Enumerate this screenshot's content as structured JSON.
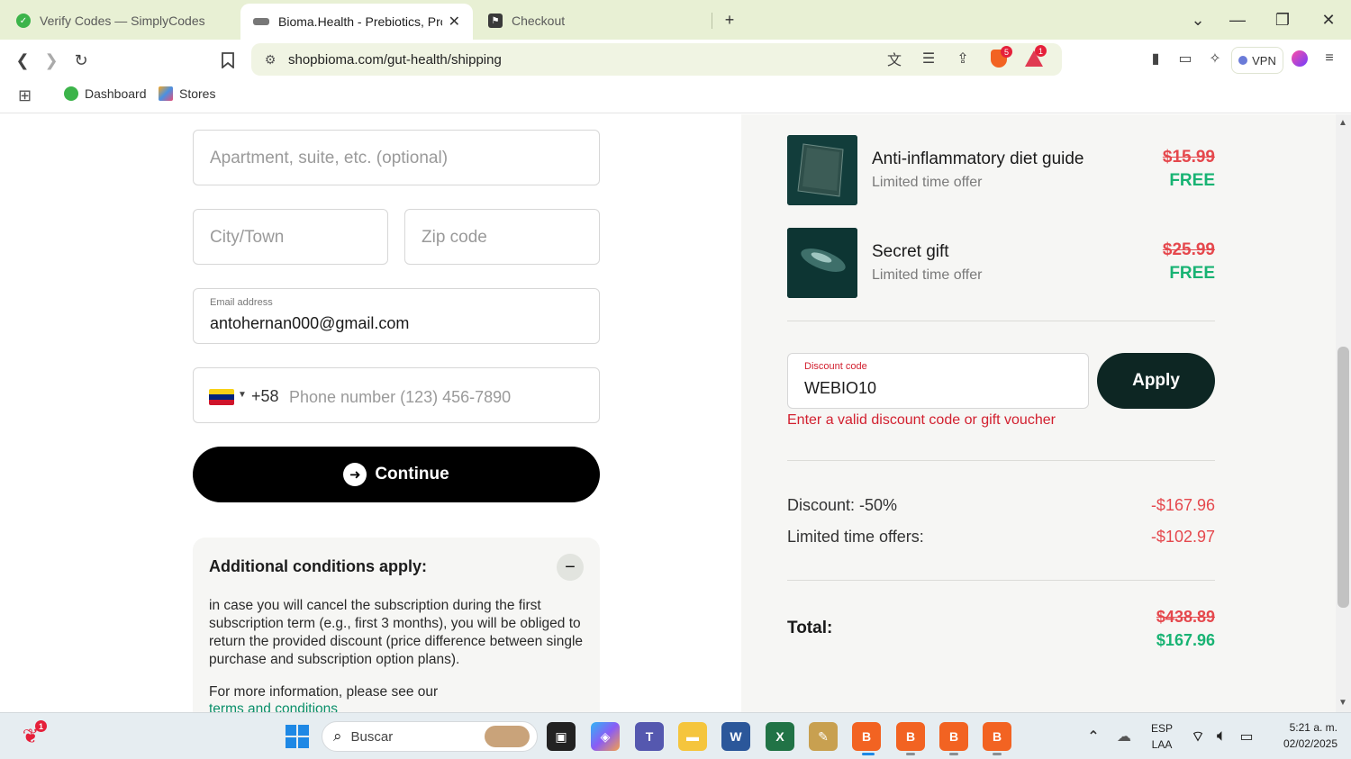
{
  "browser": {
    "tabs": [
      {
        "title": "Verify Codes — SimplyCodes",
        "active": false
      },
      {
        "title": "Bioma.Health - Prebiotics, Prob",
        "active": true
      },
      {
        "title": "Checkout",
        "active": false
      }
    ],
    "new_tab_symbol": "+",
    "url": "shopbioma.com/gut-health/shipping",
    "shield_badge": "5",
    "rewards_badge": "1",
    "vpn_label": "VPN",
    "bookmarks": [
      "Dashboard",
      "Stores"
    ]
  },
  "form": {
    "apartment_placeholder": "Apartment, suite, etc. (optional)",
    "city_placeholder": "City/Town",
    "zip_placeholder": "Zip code",
    "email_label": "Email address",
    "email_value": "antohernan000@gmail.com",
    "phone_prefix": "+58",
    "phone_placeholder": "Phone number (123) 456-7890",
    "continue_label": "Continue"
  },
  "conditions": {
    "title": "Additional conditions apply:",
    "body": "in case you will cancel the subscription during the first subscription term (e.g., first 3 months), you will be obliged to return the provided discount (price difference between single purchase and subscription option plans).",
    "more": "For more information, please see our",
    "link": "terms and conditions"
  },
  "order": {
    "offers": [
      {
        "name": "Anti-inflammatory diet guide",
        "sub": "Limited time offer",
        "old_price": "$15.99",
        "new_price": "FREE"
      },
      {
        "name": "Secret gift",
        "sub": "Limited time offer",
        "old_price": "$25.99",
        "new_price": "FREE"
      }
    ],
    "discount_label": "Discount code",
    "discount_value": "WEBIO10",
    "apply_label": "Apply",
    "error": "Enter a valid discount code or gift voucher",
    "summary": [
      {
        "label": "Discount: -50%",
        "amount": "-$167.96"
      },
      {
        "label": "Limited time offers:",
        "amount": "-$102.97"
      }
    ],
    "total_label": "Total:",
    "total_old": "$438.89",
    "total_new": "$167.96"
  },
  "taskbar": {
    "search_text": "Buscar",
    "lang_top": "ESP",
    "lang_bottom": "LAA",
    "time": "5:21 a. m.",
    "date": "02/02/2025",
    "notif_badge": "1"
  },
  "colors": {
    "chrome_bg": "#e8f0d4",
    "accent_red": "#e5484d",
    "accent_green": "#18b373",
    "apply_bg": "#0d2623"
  }
}
